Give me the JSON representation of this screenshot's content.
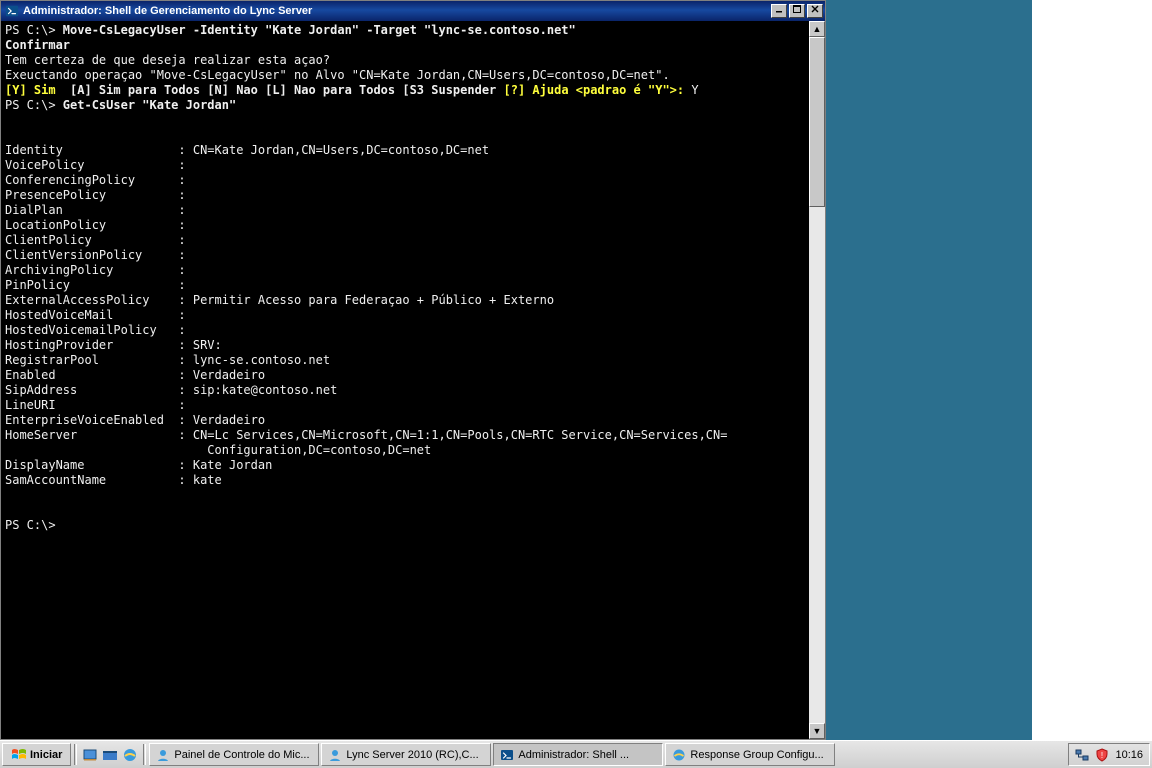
{
  "window": {
    "title": "Administrador: Shell de Gerenciamento do Lync Server"
  },
  "terminal": {
    "prompt": "PS C:\\>",
    "cmd_move": " Move-CsLegacyUser -Identity \"Kate Jordan\" -Target \"lync-se.contoso.net\"",
    "confirm_header": "Confirmar",
    "confirm_q": "Tem certeza de que deseja realizar esta açao?",
    "confirm_exec": "Exeuctando operaçao \"Move-CsLegacyUser\" no Alvo \"CN=Kate Jordan,CN=Users,DC=contoso,DC=net\".",
    "opt_yes": "[Y] Sim",
    "opt_rest": "  [A] Sim para Todos [N] Nao [L] Nao para Todos [S3 Suspender ",
    "opt_help": "[?] Ajuda <padrao é \"Y\">:",
    "opt_answer": " Y",
    "cmd_get": " Get-CsUser \"Kate Jordan\"",
    "blank": "",
    "props": [
      {
        "k": "Identity",
        "v": "CN=Kate Jordan,CN=Users,DC=contoso,DC=net"
      },
      {
        "k": "VoicePolicy",
        "v": ""
      },
      {
        "k": "ConferencingPolicy",
        "v": ""
      },
      {
        "k": "PresencePolicy",
        "v": ""
      },
      {
        "k": "DialPlan",
        "v": ""
      },
      {
        "k": "LocationPolicy",
        "v": ""
      },
      {
        "k": "ClientPolicy",
        "v": ""
      },
      {
        "k": "ClientVersionPolicy",
        "v": ""
      },
      {
        "k": "ArchivingPolicy",
        "v": ""
      },
      {
        "k": "PinPolicy",
        "v": ""
      },
      {
        "k": "ExternalAccessPolicy",
        "v": "Permitir Acesso para Federaçao + Público + Externo"
      },
      {
        "k": "HostedVoiceMail",
        "v": ""
      },
      {
        "k": "HostedVoicemailPolicy",
        "v": ""
      },
      {
        "k": "HostingProvider",
        "v": "SRV:"
      },
      {
        "k": "RegistrarPool",
        "v": "lync-se.contoso.net"
      },
      {
        "k": "Enabled",
        "v": "Verdadeiro"
      },
      {
        "k": "SipAddress",
        "v": "sip:kate@contoso.net"
      },
      {
        "k": "LineURI",
        "v": ""
      },
      {
        "k": "EnterpriseVoiceEnabled",
        "v": "Verdadeiro"
      },
      {
        "k": "HomeServer",
        "v": "CN=Lc Services,CN=Microsoft,CN=1:1,CN=Pools,CN=RTC Service,CN=Services,CN="
      },
      {
        "k": "",
        "v": "Configuration,DC=contoso,DC=net",
        "cont": true
      },
      {
        "k": "DisplayName",
        "v": "Kate Jordan"
      },
      {
        "k": "SamAccountName",
        "v": "kate"
      }
    ]
  },
  "taskbar": {
    "start": "Iniciar",
    "items": [
      {
        "label": "Painel de Controle do Mic...",
        "icon": "lync"
      },
      {
        "label": "Lync Server 2010 (RC),C...",
        "icon": "lync"
      },
      {
        "label": "Administrador: Shell ...",
        "icon": "console",
        "active": true
      },
      {
        "label": "Response Group Configu...",
        "icon": "ie"
      }
    ],
    "clock": "10:16"
  }
}
